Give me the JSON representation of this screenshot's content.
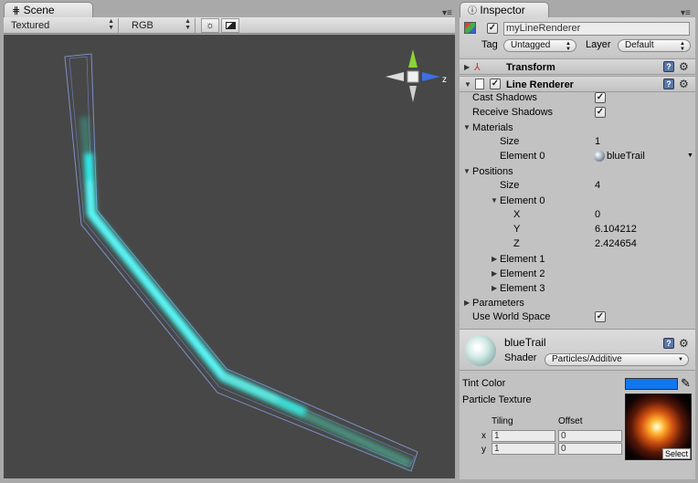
{
  "scene_tab": {
    "title": "Scene",
    "menu": "▾≡"
  },
  "scene_toolbar": {
    "render_mode": "Textured",
    "color_mode": "RGB"
  },
  "gizmo": {
    "axis_label": "z"
  },
  "inspector_tab": {
    "title": "Inspector",
    "menu": "▾≡"
  },
  "object": {
    "name": "myLineRenderer",
    "tag_label": "Tag",
    "tag_value": "Untagged",
    "layer_label": "Layer",
    "layer_value": "Default"
  },
  "transform": {
    "title": "Transform"
  },
  "line_renderer": {
    "title": "Line Renderer",
    "cast_shadows_label": "Cast Shadows",
    "receive_shadows_label": "Receive Shadows",
    "materials_label": "Materials",
    "materials_size_label": "Size",
    "materials_size_value": "1",
    "element0_label": "Element 0",
    "element0_value": "blueTrail",
    "positions_label": "Positions",
    "positions_size_label": "Size",
    "positions_size_value": "4",
    "pos_element0_label": "Element 0",
    "x_label": "X",
    "x_value": "0",
    "y_label": "Y",
    "y_value": "6.104212",
    "z_label": "Z",
    "z_value": "2.424654",
    "element1_label": "Element 1",
    "element2_label": "Element 2",
    "element3_label": "Element 3",
    "parameters_label": "Parameters",
    "world_space_label": "Use World Space"
  },
  "material": {
    "name": "blueTrail",
    "shader_label": "Shader",
    "shader_value": "Particles/Additive",
    "tint_label": "Tint Color",
    "tint_color": "#1177ee",
    "texture_label": "Particle Texture",
    "tiling_label": "Tiling",
    "offset_label": "Offset",
    "x_axis": "x",
    "y_axis": "y",
    "tiling_x": "1",
    "tiling_y": "1",
    "offset_x": "0",
    "offset_y": "0",
    "select_label": "Select"
  },
  "colors": {
    "scene_bg": "#474747",
    "trail": "#38f2f2",
    "inspector_bg": "#c2c2c2"
  }
}
